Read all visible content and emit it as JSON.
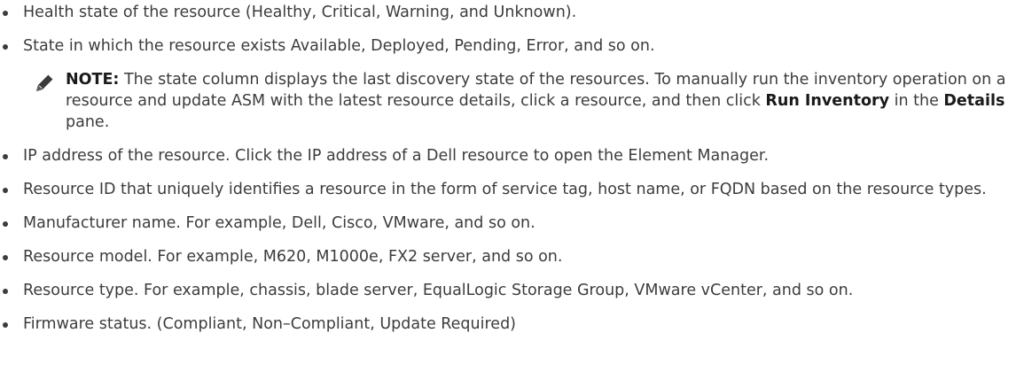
{
  "items": [
    "Health state of the resource (Healthy, Critical, Warning, and Unknown).",
    "State in which the resource exists Available, Deployed, Pending, Error, and so on.",
    "IP address of the resource. Click the IP address of a Dell resource to open the Element Manager.",
    "Resource ID that uniquely identifies a resource in the form of service tag, host name, or FQDN based on the resource types.",
    "Manufacturer name. For example, Dell, Cisco, VMware, and so on.",
    "Resource model. For example, M620, M1000e, FX2 server, and so on.",
    "Resource type. For example, chassis, blade server, EqualLogic Storage Group, VMware vCenter, and so on.",
    "Firmware status. (Compliant, Non–Compliant, Update Required)"
  ],
  "note": {
    "icon": "pencil-note-icon",
    "label": "NOTE:",
    "text_1": " The state column displays the last discovery state of the resources. To manually run the inventory operation on a resource and update ASM with the latest resource details, click a resource, and then click ",
    "bold_1": "Run Inventory",
    "text_2": " in the ",
    "bold_2": "Details",
    "text_3": " pane."
  }
}
